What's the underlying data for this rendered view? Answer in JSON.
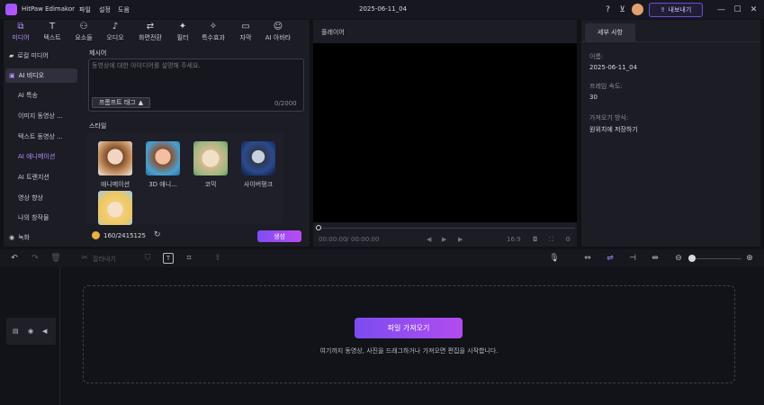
{
  "app": {
    "title": "HitPaw Edimakor",
    "menus": [
      "파일",
      "설정",
      "도움"
    ],
    "project_name": "2025-06-11_04",
    "export_label": "내보내기"
  },
  "toolbar": {
    "tabs": [
      {
        "label": "미디어",
        "icon": "media-icon"
      },
      {
        "label": "텍스트",
        "icon": "text-icon"
      },
      {
        "label": "요소들",
        "icon": "elements-icon"
      },
      {
        "label": "오디오",
        "icon": "audio-icon"
      },
      {
        "label": "화면전환",
        "icon": "transition-icon"
      },
      {
        "label": "필터",
        "icon": "filter-icon"
      },
      {
        "label": "특수효과",
        "icon": "effects-icon"
      },
      {
        "label": "자막",
        "icon": "subtitle-icon"
      },
      {
        "label": "AI 아바타",
        "icon": "avatar-icon"
      }
    ]
  },
  "sidebar": {
    "items": [
      "로컬 미디어",
      "AI 비디오",
      "AI 특송",
      "이미지 동영상 ...",
      "텍스트 동영상 ...",
      "AI 애니메이션",
      "AI 트랜지션",
      "영상 향상",
      "나의 창작물"
    ],
    "record_label": "녹화"
  },
  "prompt": {
    "section_label": "제시어",
    "placeholder": "동영상에 대한 아이디어를 설명해 주세요.",
    "tag_button": "프롬프트 태그",
    "counter": "0/2000"
  },
  "styles": {
    "section_label": "스타일",
    "items": [
      "애니메이션",
      "3D 애니...",
      "코믹",
      "사이버펑크",
      ""
    ]
  },
  "credits": {
    "value": "160/2415125"
  },
  "generate_label": "생성",
  "player": {
    "title": "플레이어",
    "time_current": "00:00:00",
    "time_total": "00:00:00",
    "aspect": "16:9"
  },
  "properties": {
    "tab": "세부 사항",
    "fields": [
      {
        "label": "이름:",
        "value": "2025-06-11_04"
      },
      {
        "label": "프레임 속도:",
        "value": "30"
      },
      {
        "label": "가져오기 방식:",
        "value": "원위치에 저장하기"
      }
    ]
  },
  "timeline": {
    "split_label": "잘라내기",
    "import_button": "파일 가져오기",
    "hint": "여기까지 동영상, 사진을 드래그하거나 가져오면 편집을 시작합니다."
  },
  "colors": {
    "accent": "#8a5cff",
    "bg": "#111218",
    "panel": "#1b1c24"
  }
}
